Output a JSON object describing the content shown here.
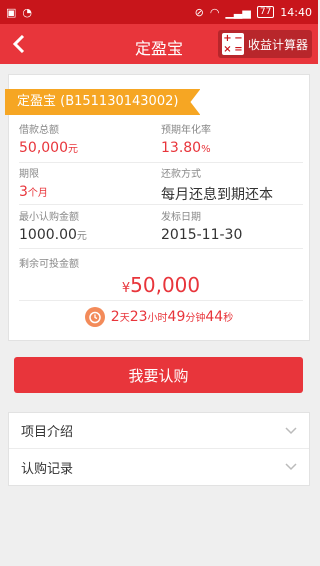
{
  "status_bar": {
    "time": "14:40",
    "battery": "77"
  },
  "nav": {
    "title": "定盈宝",
    "calculator_label": "收益计算器"
  },
  "product": {
    "name": "定盈宝 (B151130143002)",
    "total_label": "借款总额",
    "total_value": "50,000",
    "total_unit": "元",
    "rate_label": "预期年化率",
    "rate_value": "13.80",
    "rate_unit": "%",
    "term_label": "期限",
    "term_value": "3",
    "term_unit": "个月",
    "repay_label": "还款方式",
    "repay_value": "每月还息到期还本",
    "min_label": "最小认购金额",
    "min_value": "1000.00",
    "min_unit": "元",
    "date_label": "发标日期",
    "date_value": "2015-11-30",
    "remain_label": "剩余可投金额",
    "remain_currency": "¥",
    "remain_value": "50,000"
  },
  "countdown": {
    "days": "2",
    "days_unit": "天",
    "hours": "23",
    "hours_unit": "小时",
    "minutes": "49",
    "minutes_unit": "分钟",
    "seconds": "44",
    "seconds_unit": "秒"
  },
  "buy_button": "我要认购",
  "sections": [
    {
      "label": "项目介绍"
    },
    {
      "label": "认购记录"
    }
  ],
  "colors": {
    "primary": "#e8353b",
    "status_bar": "#c8151b",
    "ribbon": "#f6a623"
  }
}
